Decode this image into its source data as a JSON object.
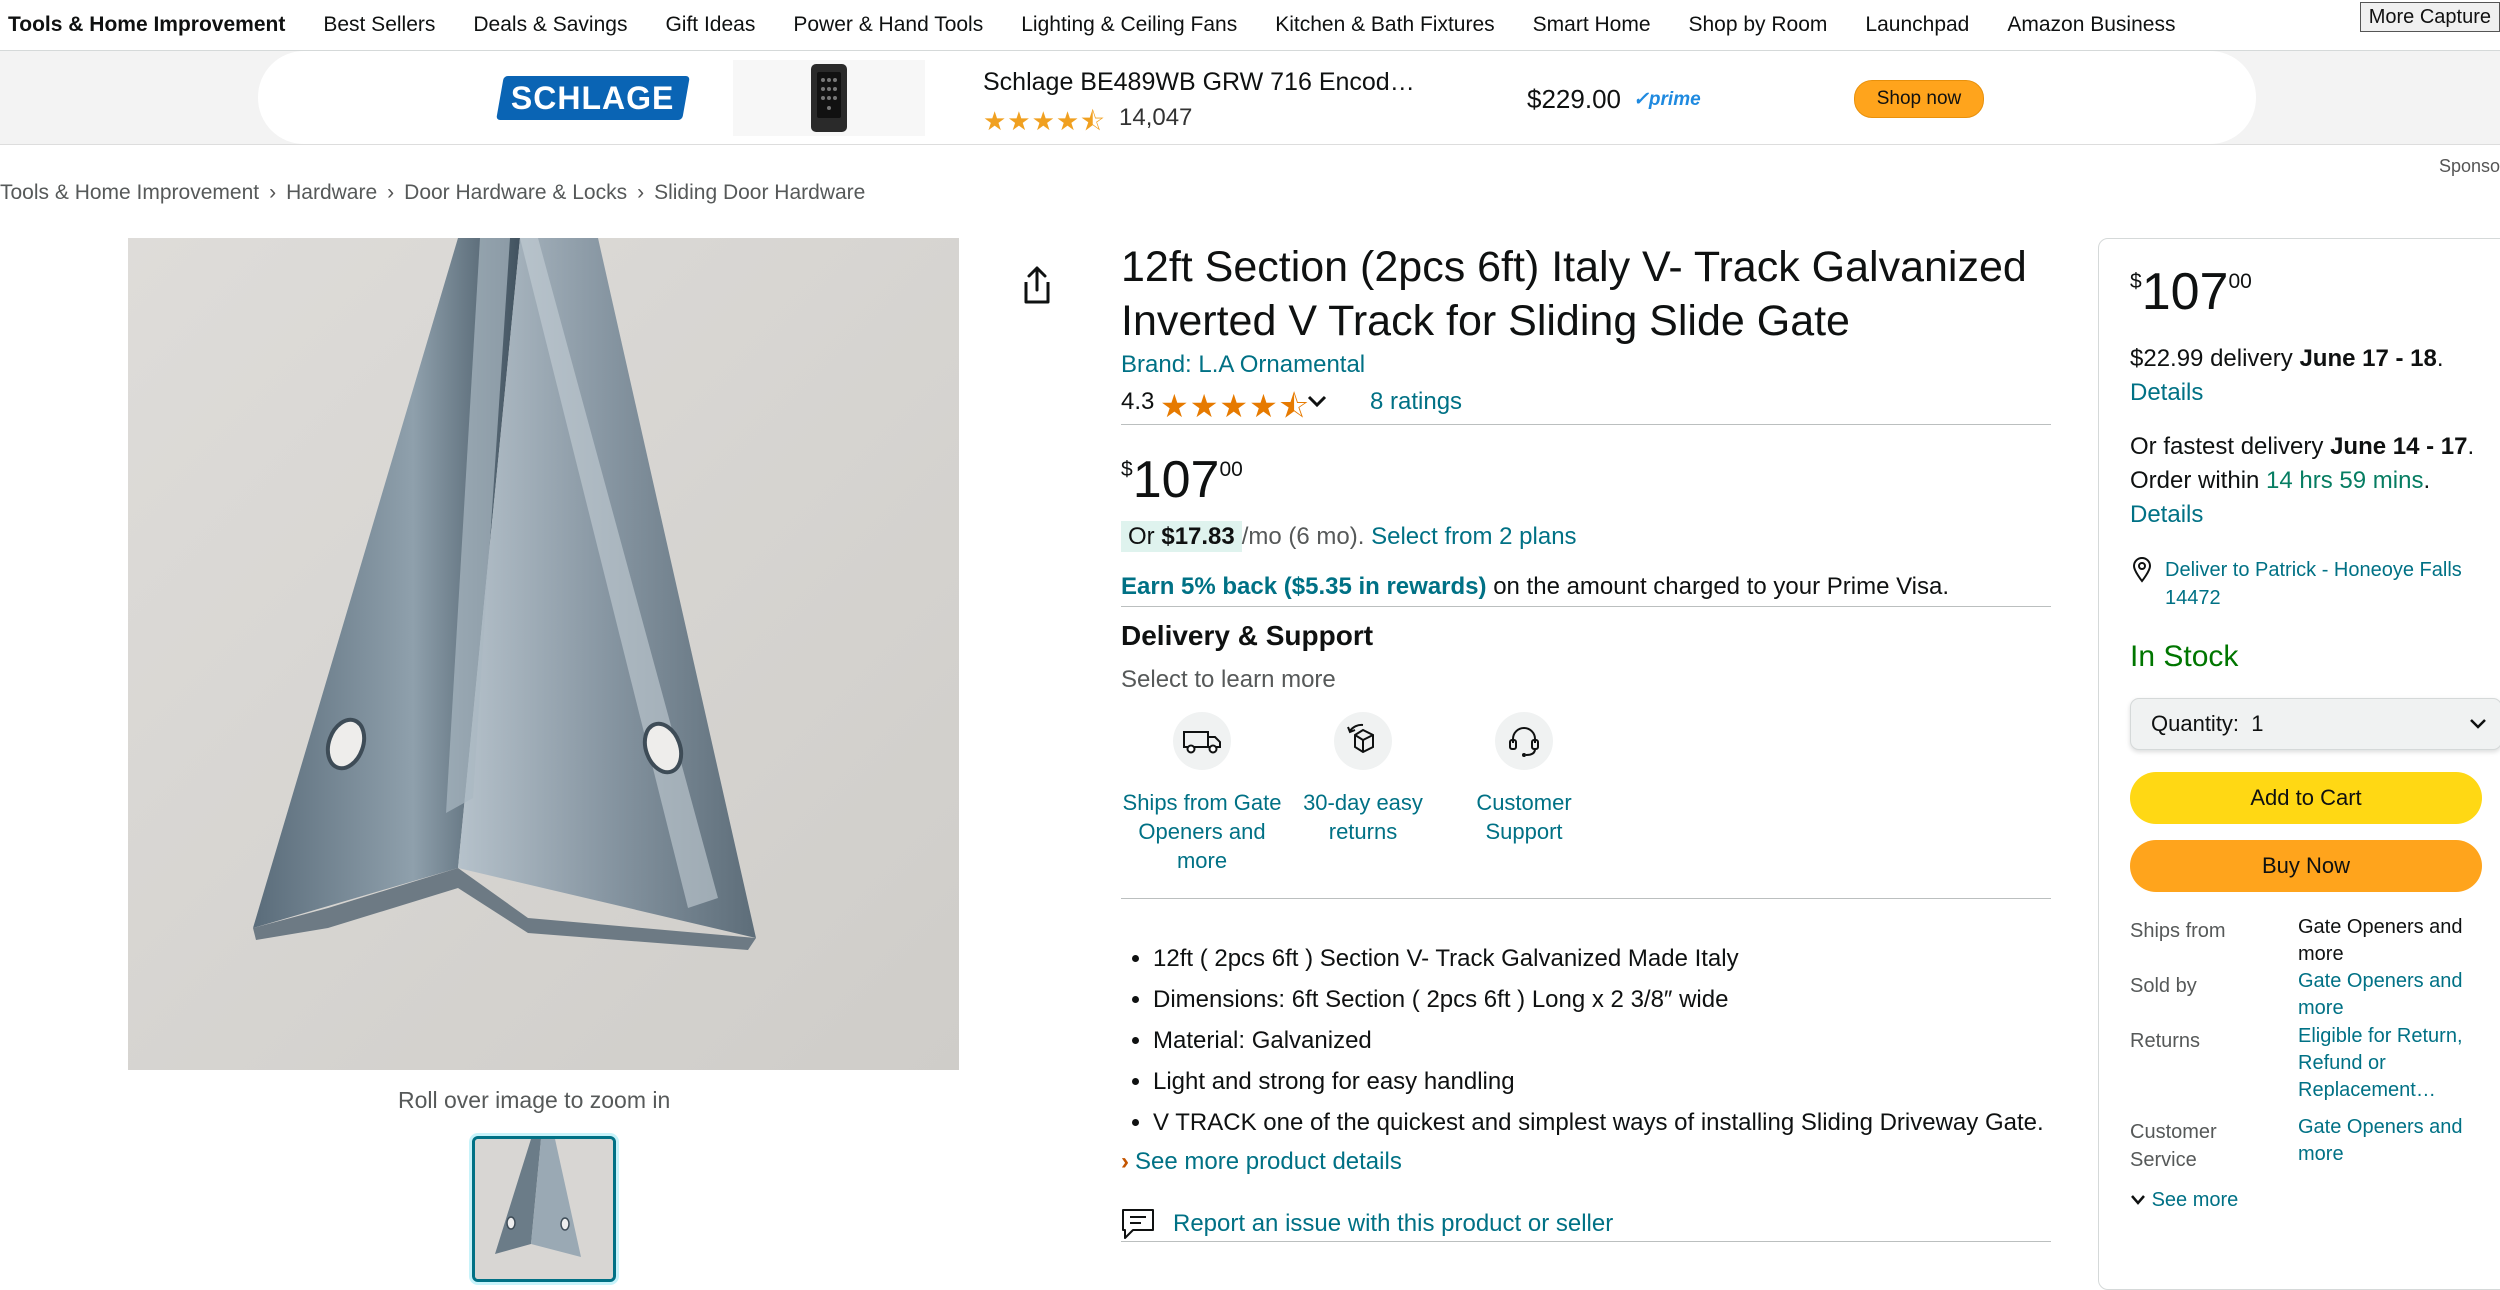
{
  "nav": {
    "categories": [
      "Tools & Home Improvement",
      "Best Sellers",
      "Deals & Savings",
      "Gift Ideas",
      "Power & Hand Tools",
      "Lighting & Ceiling Fans",
      "Kitchen & Bath Fixtures",
      "Smart Home",
      "Shop by Room",
      "Launchpad",
      "Amazon Business"
    ],
    "more_capture": "More Capture"
  },
  "banner": {
    "brand_logo": "SCHLAGE",
    "product_title": "Schlage BE489WB GRW 716 Encod…",
    "stars": "★★★★⯪",
    "rating_count": "14,047",
    "price": "$229.00",
    "prime": "✓prime",
    "shop_button": "Shop now",
    "sponsored": "Sponso"
  },
  "breadcrumb": [
    "Tools & Home Improvement",
    "Hardware",
    "Door Hardware & Locks",
    "Sliding Door Hardware"
  ],
  "breadcrumb_separator": "›",
  "gallery": {
    "zoom_hint": "Roll over image to zoom in"
  },
  "product": {
    "title": "12ft Section (2pcs 6ft) Italy V- Track Galvanized Inverted V Track for Sliding Slide Gate",
    "brand": "Brand: L.A Ornamental",
    "rating": "4.3",
    "rating_value": 4.3,
    "stars": "★★★★⯪",
    "ratings_count": "8 ratings",
    "price": {
      "symbol": "$",
      "whole": "107",
      "fraction": "00"
    },
    "installment": {
      "prefix": "Or",
      "amount": "$17.83",
      "suffix": "/mo (6 mo).",
      "plans_link": "Select from 2 plans"
    },
    "rewards": {
      "link": "Earn 5% back ($5.35 in rewards)",
      "text": "on the amount charged to your Prime Visa."
    },
    "delivery_heading": "Delivery & Support",
    "select_learn": "Select to learn more",
    "services": [
      {
        "icon": "truck-icon",
        "label": "Ships from Gate Openers and more"
      },
      {
        "icon": "returns-icon",
        "label": "30-day easy returns"
      },
      {
        "icon": "headset-icon",
        "label": "Customer Support"
      }
    ],
    "bullets": [
      "12ft ( 2pcs 6ft ) Section V- Track Galvanized Made Italy",
      "Dimensions: 6ft Section ( 2pcs 6ft ) Long x 2 3/8″ wide",
      "Material: Galvanized",
      "Light and strong for easy handling",
      "V TRACK one of the quickest and simplest ways of installing Sliding Driveway Gate."
    ],
    "see_more_details": "See more product details",
    "see_more_chevron": "›",
    "report_issue": "Report an issue with this product or seller"
  },
  "buybox": {
    "price": {
      "symbol": "$",
      "whole": "107",
      "fraction": "00"
    },
    "delivery": {
      "cost": "$22.99 delivery",
      "dates": "June 17 - 18",
      "details": "Details"
    },
    "fastest": {
      "prefix": "Or fastest delivery",
      "dates": "June 14 - 17",
      "order_within": "Order within",
      "countdown": "14 hrs 59 mins",
      "details": "Details"
    },
    "deliver_to": "Deliver to Patrick - Honeoye Falls 14472",
    "stock": "In Stock",
    "quantity_label": "Quantity:",
    "quantity_value": "1",
    "add_to_cart": "Add to Cart",
    "buy_now": "Buy Now",
    "meta": [
      {
        "label": "Ships from",
        "value": "Gate Openers and more",
        "link": false
      },
      {
        "label": "Sold by",
        "value": "Gate Openers and more",
        "link": true
      },
      {
        "label": "Returns",
        "value": "Eligible for Return, Refund or Replacement…",
        "link": true
      },
      {
        "label": "Customer Service",
        "value": "Gate Openers and more",
        "link": true
      }
    ],
    "see_more": "See more"
  }
}
